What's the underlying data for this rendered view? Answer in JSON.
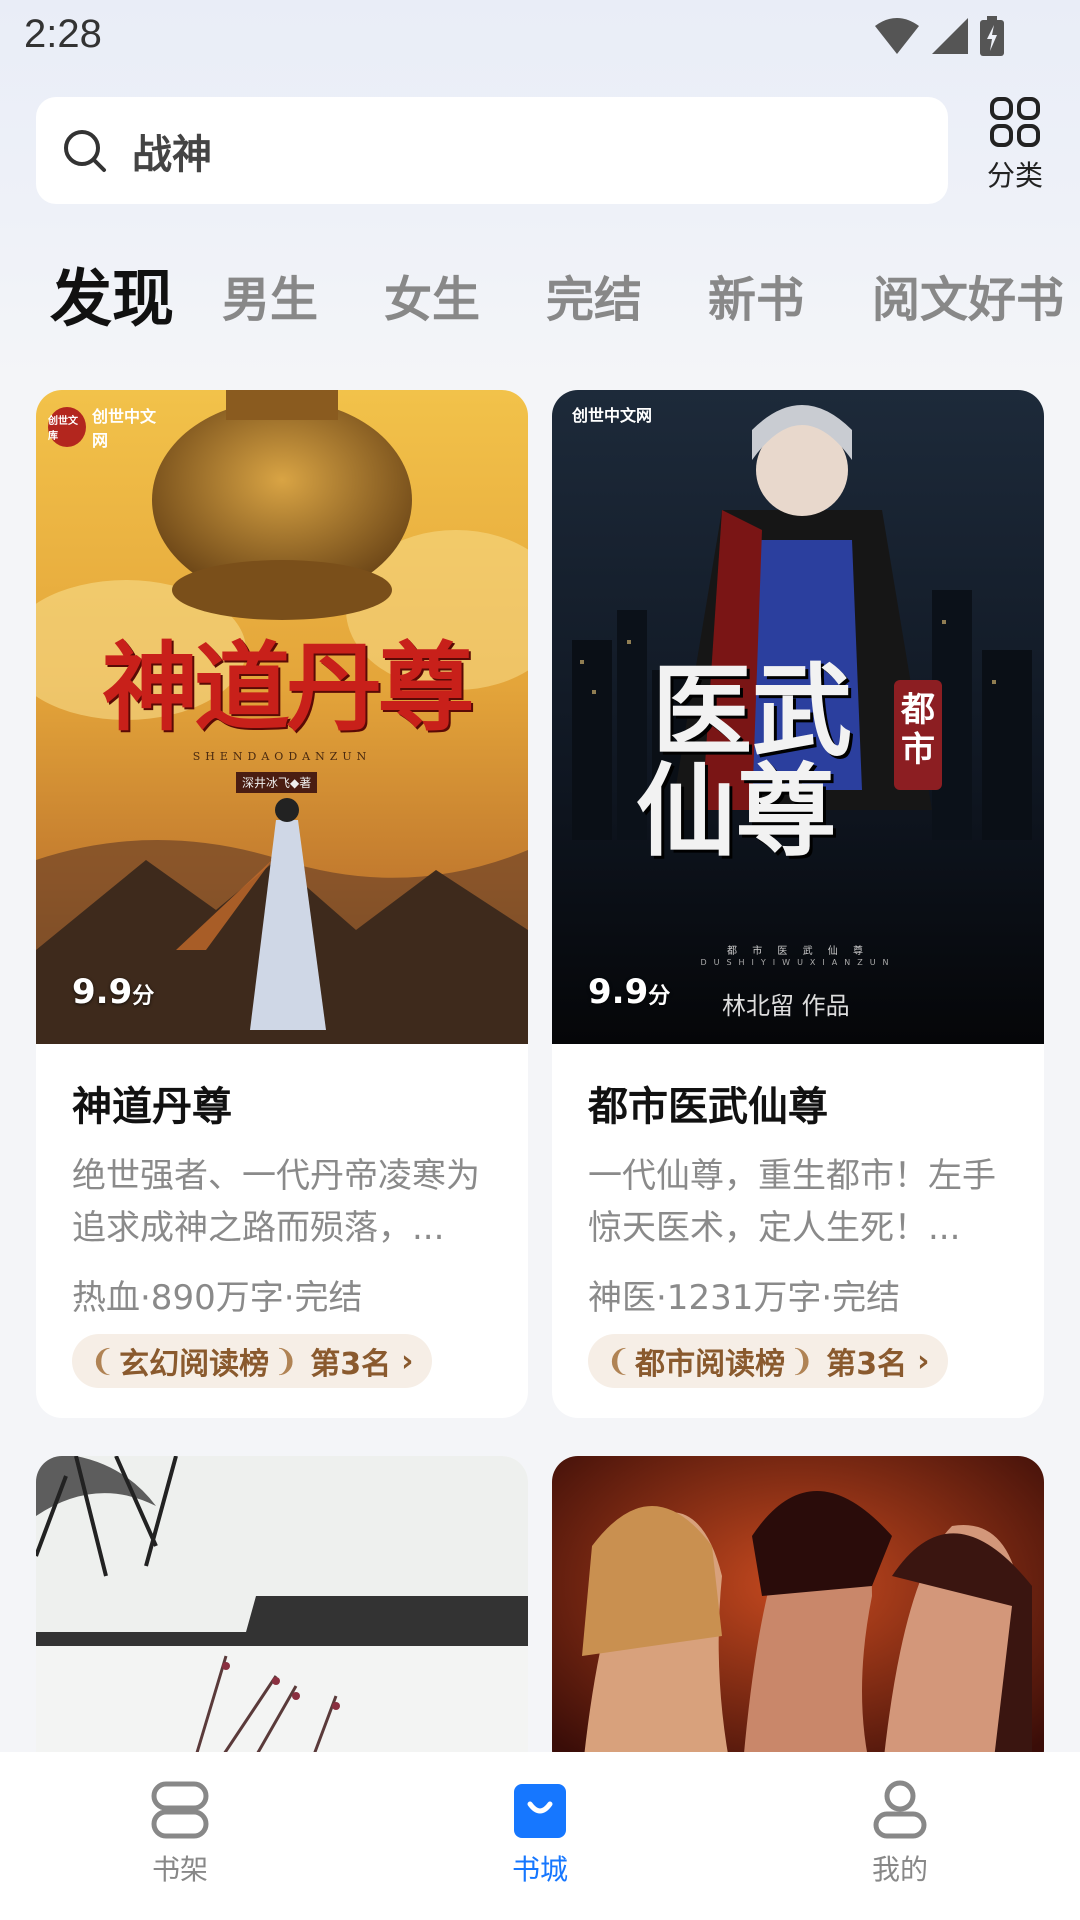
{
  "status_bar": {
    "time": "2:28",
    "icons": [
      "wifi-icon",
      "signal-icon",
      "battery-charging-icon"
    ]
  },
  "search": {
    "placeholder": "战神",
    "icon": "search-icon"
  },
  "category": {
    "label": "分类",
    "icon": "grid-icon"
  },
  "tabs": [
    {
      "label": "发现",
      "active": true
    },
    {
      "label": "男生"
    },
    {
      "label": "女生"
    },
    {
      "label": "完结"
    },
    {
      "label": "新书"
    },
    {
      "label": "阅文好书"
    }
  ],
  "books": [
    {
      "title": "神道丹尊",
      "score": "9.9",
      "score_unit": "分",
      "description": "绝世强者、一代丹帝凌寒为追求成神之路而殒落，...",
      "meta": "热血·890万字·完结",
      "rank_list": "玄幻阅读榜",
      "rank_position": "第3名",
      "cover": {
        "logo": "创世中文网",
        "side_text": "创世文库",
        "title_art": "神道丹尊",
        "pinyin": "SHENDAODANZUN",
        "author_line": "深井冰飞◆著"
      }
    },
    {
      "title": "都市医武仙尊",
      "score": "9.9",
      "score_unit": "分",
      "description": "一代仙尊，重生都市！左手惊天医术，定人生死！...",
      "meta": "神医·1231万字·完结",
      "rank_list": "都市阅读榜",
      "rank_position": "第3名",
      "cover": {
        "logo": "创世中文网",
        "title_art_1": "医武",
        "title_art_2": "仙尊",
        "tag": "都市",
        "subtitle": "都 市 医 武 仙 尊",
        "pinyin": "DUSHIYIWUXIANZUN",
        "author_line": "林北留 作品"
      }
    }
  ],
  "bottom_nav": [
    {
      "label": "书架",
      "icon": "bookshelf-icon"
    },
    {
      "label": "书城",
      "icon": "store-bag-icon",
      "active": true
    },
    {
      "label": "我的",
      "icon": "profile-icon"
    }
  ],
  "colors": {
    "accent": "#1677ff",
    "rank_badge_bg": "#f6eee6",
    "rank_badge_text": "#8a5a2e"
  }
}
